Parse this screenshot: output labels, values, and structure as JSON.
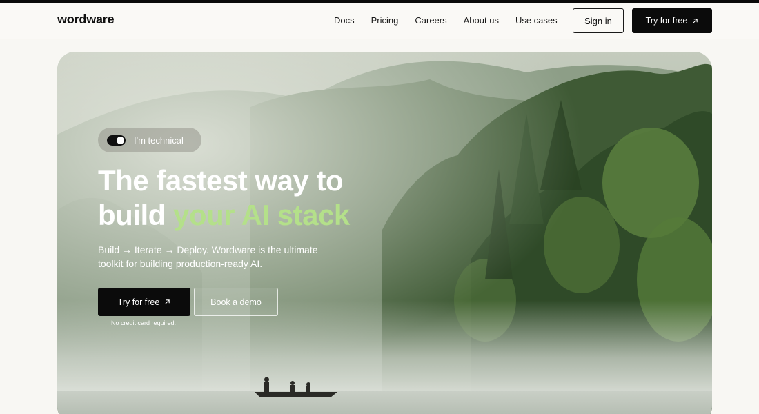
{
  "header": {
    "logo": "wordware",
    "nav": [
      "Docs",
      "Pricing",
      "Careers",
      "About us",
      "Use cases"
    ],
    "sign_in": "Sign in",
    "try_free": "Try for free"
  },
  "hero": {
    "toggle_label": "I'm technical",
    "toggle_on": true,
    "headline_line1": "The fastest way to",
    "headline_line2_prefix": "build ",
    "headline_line2_accent": "your AI stack",
    "subtitle": "Build → Iterate → Deploy. Wordware is the ultimate toolkit for building production-ready AI.",
    "cta_primary": "Try for free",
    "cta_secondary": "Book a demo",
    "note": "No credit card required."
  },
  "colors": {
    "accent_green": "#b4e08a",
    "button_dark": "#0b0b0b",
    "page_bg": "#f8f7f3"
  }
}
